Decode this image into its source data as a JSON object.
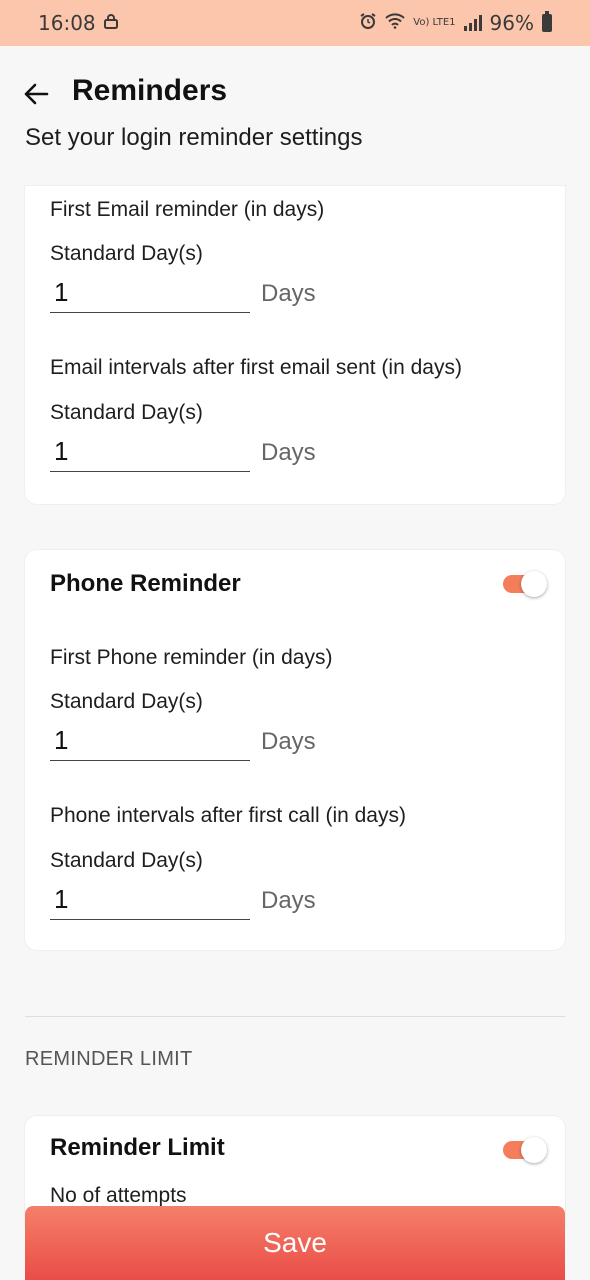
{
  "status_bar": {
    "time": "16:08",
    "network": "Vo) LTE1",
    "battery": "96%"
  },
  "header": {
    "title": "Reminders",
    "subtitle": "Set your login reminder settings"
  },
  "email_card": {
    "first_reminder": {
      "title": "First Email reminder (in days)",
      "std_label": "Standard Day(s)",
      "value": "1",
      "unit": "Days"
    },
    "interval": {
      "title": "Email intervals after first email sent (in days)",
      "std_label": "Standard Day(s)",
      "value": "1",
      "unit": "Days"
    }
  },
  "phone_card": {
    "heading": "Phone Reminder",
    "toggle_on": true,
    "first_reminder": {
      "title": "First Phone reminder (in days)",
      "std_label": "Standard Day(s)",
      "value": "1",
      "unit": "Days"
    },
    "interval": {
      "title": "Phone intervals after first call (in days)",
      "std_label": "Standard Day(s)",
      "value": "1",
      "unit": "Days"
    }
  },
  "limit_section": {
    "label": "REMINDER LIMIT",
    "heading": "Reminder Limit",
    "toggle_on": true,
    "attempts_label": "No of attempts"
  },
  "footer": {
    "save_label": "Save"
  },
  "colors": {
    "status_bar": "#fcc6ac",
    "accent": "#f47e5c",
    "save_gradient_top": "#f57f6b",
    "save_gradient_bottom": "#ea4d47"
  }
}
